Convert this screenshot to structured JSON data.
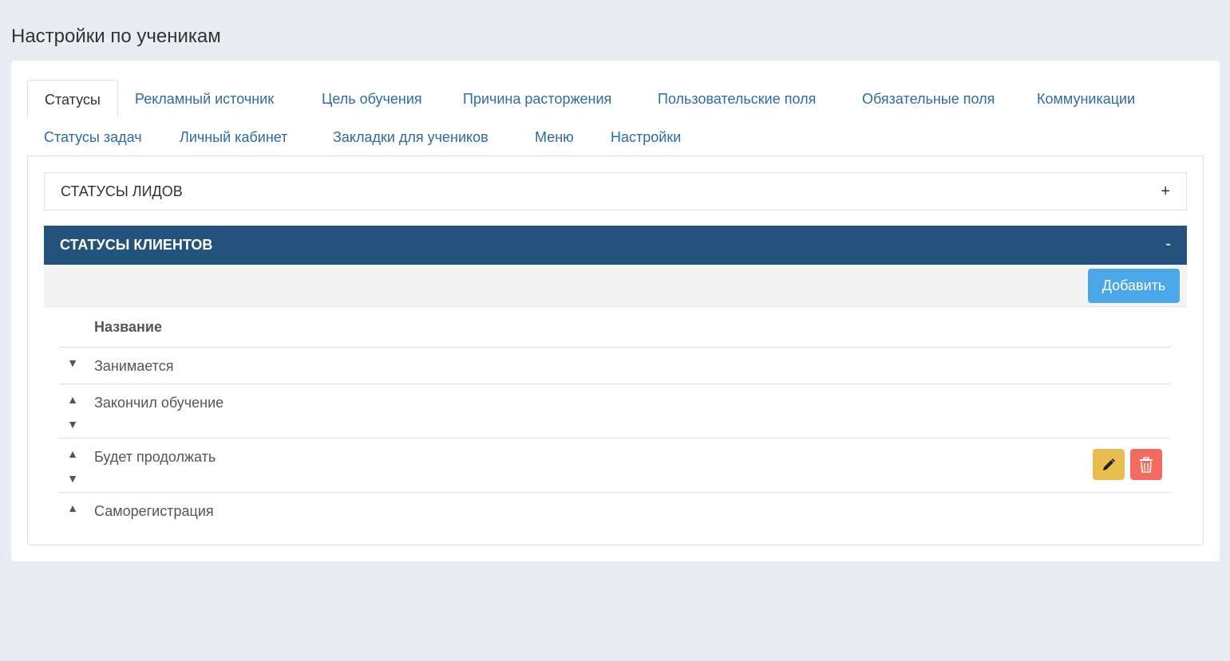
{
  "page": {
    "title": "Настройки по ученикам"
  },
  "tabs": [
    "Статусы",
    "Рекламный источник",
    "Цель обучения",
    "Причина расторжения",
    "Пользовательские поля",
    "Обязательные поля",
    "Коммуникации",
    "Статусы задач",
    "Личный кабинет",
    "Закладки для учеников",
    "Меню",
    "Настройки"
  ],
  "active_tab": "Статусы",
  "lead_panel": {
    "title": "СТАТУСЫ ЛИДОВ",
    "toggle": "+"
  },
  "client_panel": {
    "title": "СТАТУСЫ КЛИЕНТОВ",
    "toggle": "-",
    "add_label": "Добавить",
    "column_header": "Название",
    "rows": [
      {
        "name": "Занимается"
      },
      {
        "name": "Закончил обучение"
      },
      {
        "name": "Будет продолжать"
      },
      {
        "name": "Саморегистрация"
      }
    ]
  },
  "icons": {
    "up": "▲",
    "down": "▼",
    "edit": "pencil-icon",
    "delete": "trash-icon"
  },
  "colors": {
    "accent_header": "#23527c",
    "tab_link": "#2c6ca6",
    "add_button": "#4aa7e8",
    "edit_button": "#e8bf4f",
    "delete_button": "#f26b5e"
  }
}
